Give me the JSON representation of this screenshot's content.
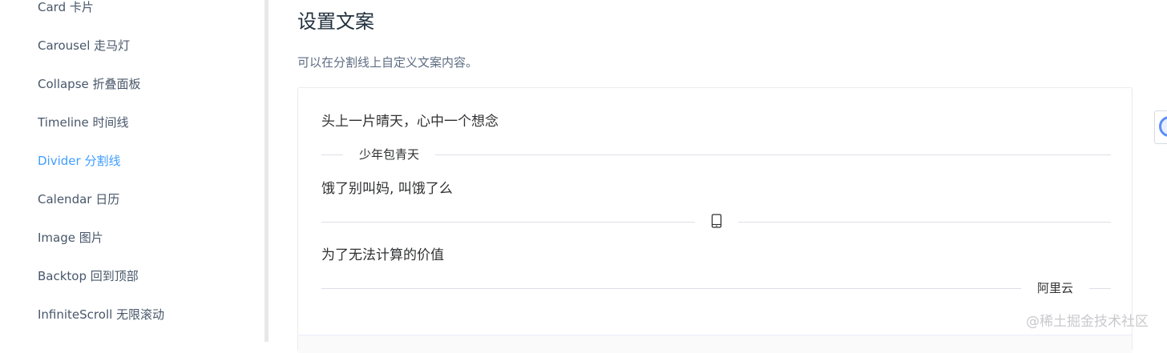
{
  "sidebar": {
    "items": [
      {
        "label": "Card 卡片",
        "active": false
      },
      {
        "label": "Carousel 走马灯",
        "active": false
      },
      {
        "label": "Collapse 折叠面板",
        "active": false
      },
      {
        "label": "Timeline 时间线",
        "active": false
      },
      {
        "label": "Divider 分割线",
        "active": true
      },
      {
        "label": "Calendar 日历",
        "active": false
      },
      {
        "label": "Image 图片",
        "active": false
      },
      {
        "label": "Backtop 回到顶部",
        "active": false
      },
      {
        "label": "InfiniteScroll 无限滚动",
        "active": false
      }
    ]
  },
  "main": {
    "title": "设置文案",
    "description": "可以在分割线上自定义文案内容。",
    "demo": {
      "line1": "头上一片晴天，心中一个想念",
      "divider1_text": "少年包青天",
      "line2": "饿了别叫妈, 叫饿了么",
      "divider2_icon": "mobile-phone-icon",
      "line3": "为了无法计算的价值",
      "divider3_text": "阿里云"
    }
  },
  "watermark": "@稀土掘金技术社区",
  "colors": {
    "accent": "#409eff",
    "divider": "#dcdfe6",
    "nav_text": "#48576a"
  }
}
